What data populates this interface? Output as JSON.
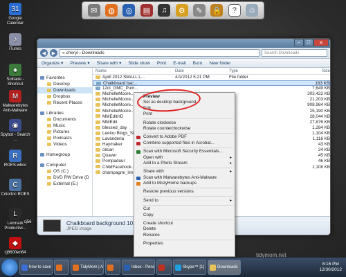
{
  "desktop_icons": [
    {
      "label": "Google Calendar",
      "color": "#2a6fd6",
      "glyph": "31"
    },
    {
      "label": "iTunes",
      "color": "#8a8fa8",
      "glyph": "♪"
    },
    {
      "label": "Solitaire - Shortcut",
      "color": "#3c7a3c",
      "glyph": "♠"
    },
    {
      "label": "Malwarebytes Anti-Malware",
      "color": "#b32020",
      "glyph": "M"
    },
    {
      "label": "Spybot - Search ...",
      "color": "#3a4a8a",
      "glyph": "◉"
    },
    {
      "label": "ROES.whcc",
      "color": "#3a6fc0",
      "glyph": "R"
    },
    {
      "label": "ColorInc ROES",
      "color": "#4a70a0",
      "glyph": "C"
    },
    {
      "label": "Lexmark Productivi...",
      "color": "#2a2a2a",
      "glyph": "L"
    },
    {
      "label": "cj6600en64",
      "color": "#c01010",
      "glyph": "◆"
    },
    {
      "label": "cj56",
      "color": "#444",
      "glyph": ""
    }
  ],
  "dock": [
    "mail-icon",
    "firefox-icon",
    "globe-icon",
    "books-icon",
    "headphones-icon",
    "gear-icon",
    "notepad-icon",
    "lock-icon",
    "help-icon",
    "trash-icon"
  ],
  "window": {
    "address": "« cheryl › Downloads",
    "search_placeholder": "Search Downloads",
    "toolbar": [
      "Organize ▾",
      "Preview ▾",
      "Share with ▾",
      "Slide show",
      "Print",
      "E-mail",
      "Burn",
      "New folder"
    ],
    "nav": [
      {
        "label": "Favorites",
        "group": true
      },
      {
        "label": "Desktop"
      },
      {
        "label": "Downloads",
        "selected": true
      },
      {
        "label": "Dropbox"
      },
      {
        "label": "Recent Places"
      },
      {
        "label": "Libraries",
        "group": true
      },
      {
        "label": "Documents"
      },
      {
        "label": "Music"
      },
      {
        "label": "Pictures"
      },
      {
        "label": "Podcasts"
      },
      {
        "label": "Videos"
      },
      {
        "label": "Homegroup",
        "group": true
      },
      {
        "label": "Computer",
        "group": true
      },
      {
        "label": "OS (C:)"
      },
      {
        "label": "DVD RW Drive (D"
      },
      {
        "label": "External (E:)"
      }
    ],
    "columns": [
      "Name",
      "Date",
      "Type",
      "Size"
    ],
    "files": [
      {
        "name": "April 2012 SMALL L...",
        "date": "4/1/2012 5:21 PM",
        "type": "File folder",
        "size": "",
        "icon": "folder"
      },
      {
        "name": "Chalkboard bac...",
        "date": "",
        "type": "",
        "size": "163 KB",
        "icon": "img",
        "selected": true
      },
      {
        "name": "12ct_GMC_Pum...",
        "date": "",
        "type": "",
        "size": "7,649 KB",
        "icon": "img"
      },
      {
        "name": "MichelleMoore...",
        "date": "",
        "type": "",
        "size": "303,422 KB",
        "icon": "folder"
      },
      {
        "name": "MichelleMoore...",
        "date": "",
        "type": "",
        "size": "21,203 KB",
        "icon": "folder"
      },
      {
        "name": "MichelleMoore...",
        "date": "",
        "type": "",
        "size": "908,984 KB",
        "icon": "folder"
      },
      {
        "name": "MichelleMoore...",
        "date": "",
        "type": "",
        "size": "25,190 KB",
        "icon": "folder"
      },
      {
        "name": "MMEditHD",
        "date": "",
        "type": "",
        "size": "28,044 KB",
        "icon": "folder"
      },
      {
        "name": "MMEdit",
        "date": "",
        "type": "",
        "size": "27,876 KB",
        "icon": "folder"
      },
      {
        "name": "blessed_day",
        "date": "",
        "type": "",
        "size": "1,284 KB",
        "icon": "folder"
      },
      {
        "name": "Leelou Blogs_Sl...",
        "date": "",
        "type": "",
        "size": "1,104 KB",
        "icon": "folder"
      },
      {
        "name": "Lavanderia",
        "date": "",
        "type": "",
        "size": "1,116 KB",
        "icon": "folder"
      },
      {
        "name": "Haymaker",
        "date": "",
        "type": "",
        "size": "43 KB",
        "icon": "folder"
      },
      {
        "name": "olican",
        "date": "",
        "type": "",
        "size": "24 KB",
        "icon": "folder"
      },
      {
        "name": "Quaver",
        "date": "",
        "type": "",
        "size": "45 KB",
        "icon": "folder"
      },
      {
        "name": "Pompadour",
        "date": "",
        "type": "",
        "size": "46 KB",
        "icon": "folder"
      },
      {
        "name": "ChildFacebook...",
        "date": "",
        "type": "",
        "size": "1,108 KB",
        "icon": "folder"
      },
      {
        "name": "champagne_lim...",
        "date": "",
        "type": "",
        "size": "",
        "icon": "folder"
      }
    ],
    "details_name": "Chalkboard background 1024x...",
    "details_type": "JPEG image"
  },
  "context_menu": [
    {
      "label": "Preview",
      "bold": true
    },
    {
      "label": "Set as desktop background"
    },
    {
      "label": "Edit"
    },
    {
      "label": "Print"
    },
    {
      "sep": true
    },
    {
      "label": "Rotate clockwise"
    },
    {
      "label": "Rotate counterclockwise"
    },
    {
      "sep": true
    },
    {
      "label": "Convert to Adobe PDF",
      "icon": "#c0282d"
    },
    {
      "label": "Combine supported files in Acrobat...",
      "icon": "#c0282d"
    },
    {
      "sep": true
    },
    {
      "label": "Scan with Microsoft Security Essentials...",
      "icon": "#2f7d32"
    },
    {
      "label": "Open with",
      "sub": true
    },
    {
      "label": "Add to a Photo Stream",
      "sub": true
    },
    {
      "sep": true
    },
    {
      "label": "Share with",
      "sub": true
    },
    {
      "label": "Scan with Malwarebytes Anti-Malware",
      "icon": "#2a5fb0"
    },
    {
      "label": "Add to MozyHome backups",
      "icon": "#e08020"
    },
    {
      "sep": true
    },
    {
      "label": "Restore previous versions"
    },
    {
      "sep": true
    },
    {
      "label": "Send to",
      "sub": true
    },
    {
      "sep": true
    },
    {
      "label": "Cut"
    },
    {
      "label": "Copy"
    },
    {
      "sep": true
    },
    {
      "label": "Create shortcut"
    },
    {
      "label": "Delete"
    },
    {
      "label": "Rename"
    },
    {
      "sep": true
    },
    {
      "label": "Properties"
    }
  ],
  "taskbar": {
    "buttons": [
      {
        "label": "how to save ...",
        "color": "#3b6fd6"
      },
      {
        "label": "",
        "color": "#e07020"
      },
      {
        "label": "TidyMom | A...",
        "color": "#e07020"
      },
      {
        "label": "",
        "color": "#e07020"
      },
      {
        "label": "Inbox - Penco...",
        "color": "#2a60b0"
      },
      {
        "label": "",
        "color": "#c03020"
      },
      {
        "label": "Skype™ [1] -...",
        "color": "#20a0e0"
      },
      {
        "label": "Downloads",
        "color": "#e8c25a",
        "active": true
      }
    ],
    "time": "8:16 PM",
    "date": "12/30/2012"
  },
  "watermark": "tidymom.net"
}
